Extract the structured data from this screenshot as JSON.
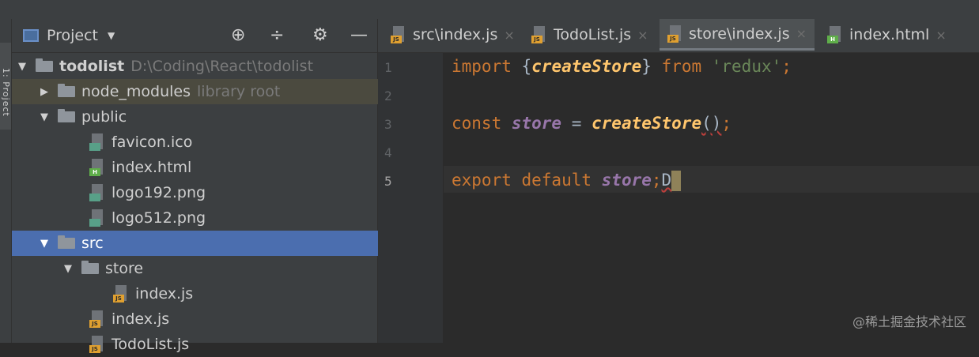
{
  "side_strip": {
    "label": "1: Project"
  },
  "project_panel": {
    "title": "Project",
    "header_buttons": [
      "⊕",
      "÷",
      "⚙",
      "—"
    ],
    "tree": [
      {
        "label": "todolist",
        "path": "D:\\Coding\\React\\todolist",
        "type": "folder",
        "expanded": true,
        "depth": 0
      },
      {
        "label": "node_modules",
        "secondary": "library root",
        "type": "folder",
        "expanded": false,
        "depth": 1
      },
      {
        "label": "public",
        "type": "folder",
        "expanded": true,
        "depth": 1
      },
      {
        "label": "favicon.ico",
        "type": "file",
        "icon": "img",
        "depth": 2
      },
      {
        "label": "index.html",
        "type": "file",
        "icon": "html",
        "depth": 2
      },
      {
        "label": "logo192.png",
        "type": "file",
        "icon": "img",
        "depth": 2
      },
      {
        "label": "logo512.png",
        "type": "file",
        "icon": "img",
        "depth": 2
      },
      {
        "label": "src",
        "type": "folder",
        "expanded": true,
        "selected": true,
        "depth": 1
      },
      {
        "label": "store",
        "type": "folder",
        "expanded": true,
        "depth": 2
      },
      {
        "label": "index.js",
        "type": "file",
        "icon": "js",
        "depth": 3
      },
      {
        "label": "index.js",
        "type": "file",
        "icon": "js",
        "depth": 2
      },
      {
        "label": "TodoList.js",
        "type": "file",
        "icon": "js",
        "depth": 2
      }
    ]
  },
  "editor": {
    "tabs": [
      {
        "label": "src\\index.js",
        "icon": "js",
        "close": "×"
      },
      {
        "label": "TodoList.js",
        "icon": "js",
        "close": "×"
      },
      {
        "label": "store\\index.js",
        "icon": "js",
        "close": "×",
        "active": true
      },
      {
        "label": "index.html",
        "icon": "html",
        "close": "×"
      }
    ],
    "line_numbers": [
      "1",
      "2",
      "3",
      "4",
      "5"
    ],
    "current_line": 5,
    "code": {
      "l1": {
        "kw1": "import",
        "brace_open": " {",
        "fn": "createStore",
        "brace_close": "} ",
        "kw2": "from",
        "str": " 'redux'",
        "semi": ";"
      },
      "l3": {
        "kw": "const",
        "var": " store",
        "eq": " = ",
        "fn": "createStore",
        "parens": "()",
        "semi": ";"
      },
      "l5": {
        "kw": "export default",
        "var": " store",
        "semi": ";",
        "typed": "D"
      }
    }
  },
  "watermark": "@稀土掘金技术社区",
  "colors": {
    "keyword": "#cc7832",
    "function": "#ffc66d",
    "variable": "#9876aa",
    "string": "#6a8759",
    "selection": "#4b6eaf"
  }
}
